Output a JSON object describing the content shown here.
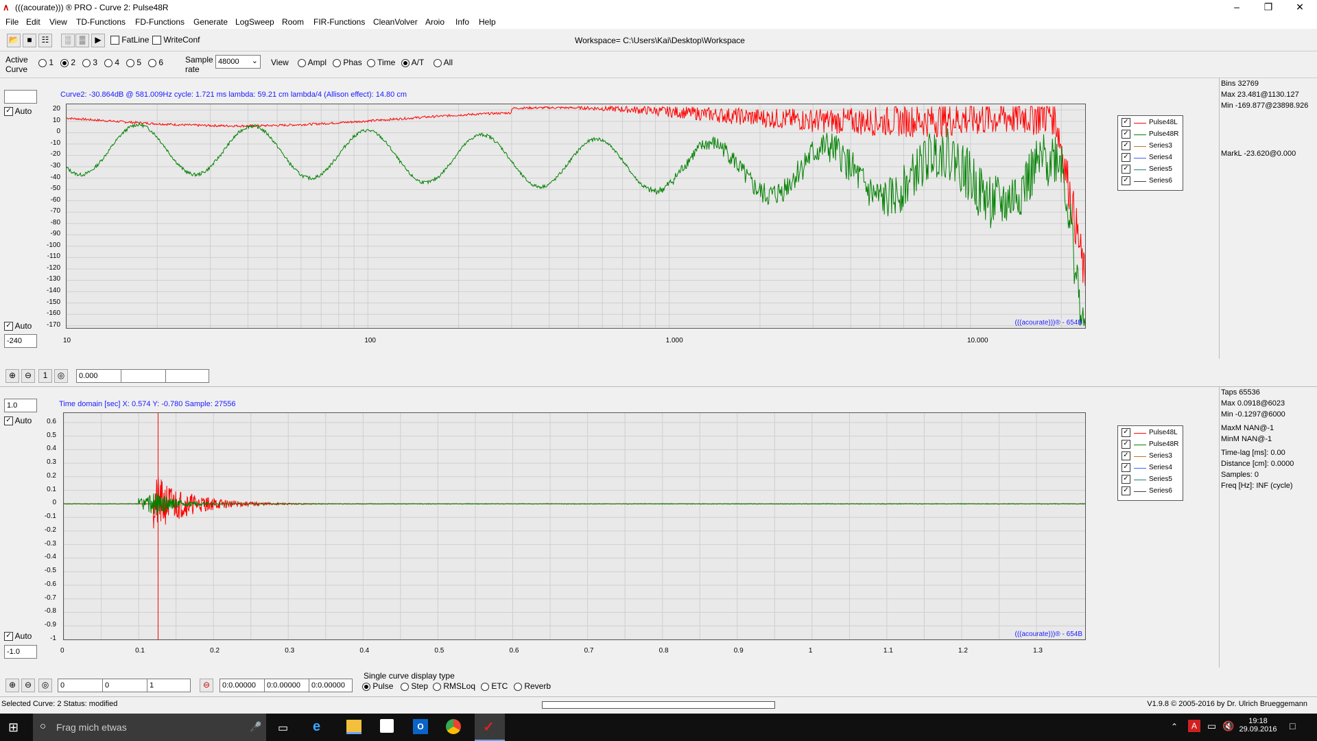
{
  "window": {
    "title": "(((acourate))) ® PRO - Curve 2: Pulse48R"
  },
  "menu": [
    "File",
    "Edit",
    "View",
    "TD-Functions",
    "FD-Functions",
    "Generate",
    "LogSweep",
    "Room",
    "FIR-Functions",
    "CleanVolver",
    "Aroio",
    "Info",
    "Help"
  ],
  "toolbar": {
    "fatline": "FatLine",
    "writeconf": "WriteConf",
    "workspace": "Workspace= C:\\Users\\Kai\\Desktop\\Workspace"
  },
  "curvebar": {
    "active_label_1": "Active",
    "active_label_2": "Curve",
    "curves": [
      "1",
      "2",
      "3",
      "4",
      "5",
      "6"
    ],
    "sample_label_1": "Sample",
    "sample_label_2": "rate",
    "sample_rate": "48000",
    "view_label": "View",
    "views": [
      "Ampl",
      "Phas",
      "Time",
      "A/T",
      "All"
    ]
  },
  "fd": {
    "top_input": "",
    "auto": "Auto",
    "bottom_input": "-240",
    "status": "Curve2:  -30.864dB @ 581.009Hz   cycle: 1.721 ms   lambda: 59.21 cm   lambda/4 (Allison effect): 14.80 cm",
    "yticks": [
      "20",
      "10",
      "0",
      "-10",
      "-20",
      "-30",
      "-40",
      "-50",
      "-60",
      "-70",
      "-80",
      "-90",
      "-100",
      "-110",
      "-120",
      "-130",
      "-140",
      "-150",
      "-160",
      "-170"
    ],
    "xticks": [
      "10",
      "100",
      "1.000",
      "10.000"
    ],
    "watermark": "(((acourate)))® - 654B",
    "legend": [
      "Pulse48L",
      "Pulse48R",
      "Series3",
      "Series4",
      "Series5",
      "Series6"
    ],
    "info": [
      "Bins 32769",
      "Max 23.481@1130.127",
      "Min -169.877@23898.926"
    ],
    "markl": "MarkL -23.620@0.000",
    "zoom_value": "0.000",
    "zoom_one": "1"
  },
  "td": {
    "top_input": "1.0",
    "auto": "Auto",
    "bottom_input": "-1.0",
    "status": "Time domain [sec]   X: 0.574   Y: -0.780   Sample: 27556",
    "yticks": [
      "0.6",
      "0.5",
      "0.4",
      "0.3",
      "0.2",
      "0.1",
      "0",
      "-0.1",
      "-0.2",
      "-0.3",
      "-0.4",
      "-0.5",
      "-0.6",
      "-0.7",
      "-0.8",
      "-0.9",
      "-1"
    ],
    "xticks": [
      "0",
      "0.1",
      "0.2",
      "0.3",
      "0.4",
      "0.5",
      "0.6",
      "0.7",
      "0.8",
      "0.9",
      "1",
      "1.1",
      "1.2",
      "1.3"
    ],
    "watermark": "(((acourate)))® - 654B",
    "legend": [
      "Pulse48L",
      "Pulse48R",
      "Series3",
      "Series4",
      "Series5",
      "Series6"
    ],
    "info": [
      "Taps 65536",
      "Max 0.0918@6023",
      "Min -0.1297@6000",
      "",
      "MaxM NAN@-1",
      "MinM NAN@-1",
      "",
      "Time-lag [ms]: 0.00",
      "Distance [cm]: 0.0000",
      "Samples:  0",
      "Freq [Hz]: INF (cycle)"
    ]
  },
  "bottom": {
    "f1": "0",
    "f2": "0",
    "f3": "1",
    "t1": "0:0.00000",
    "t2": "0:0.00000",
    "t3": "0:0.00000",
    "display_label": "Single curve display type",
    "display_types": [
      "Pulse",
      "Step",
      "RMSLoq",
      "ETC",
      "Reverb"
    ]
  },
  "statusbar": {
    "left": "Selected Curve: 2   Status: modified",
    "right": "V1.9.8 © 2005-2016 by Dr. Ulrich Brueggemann"
  },
  "taskbar": {
    "search": "Frag mich etwas",
    "time": "19:18",
    "date": "29.09.2016"
  },
  "colors": {
    "red": "#ff0000",
    "green": "#008000",
    "blue_text": "#1a1aff",
    "orange": "#c87020",
    "blue": "#4060ff",
    "teal": "#208080"
  }
}
